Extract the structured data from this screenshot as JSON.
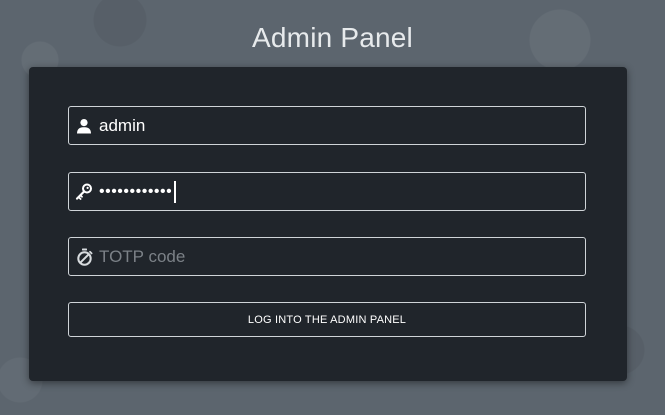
{
  "page": {
    "title": "Admin Panel"
  },
  "form": {
    "username": {
      "value": "admin",
      "icon": "user-icon"
    },
    "password": {
      "masked_value": "••••••••••••",
      "icon": "key-icon"
    },
    "totp": {
      "placeholder": "TOTP code",
      "icon": "stopwatch-icon"
    },
    "submit_label": "LOG INTO THE ADMIN PANEL"
  },
  "colors": {
    "background": "#5c656e",
    "panel": "#20252b",
    "border": "#cfd4d8",
    "text": "#ffffff",
    "placeholder": "#7b8187"
  }
}
